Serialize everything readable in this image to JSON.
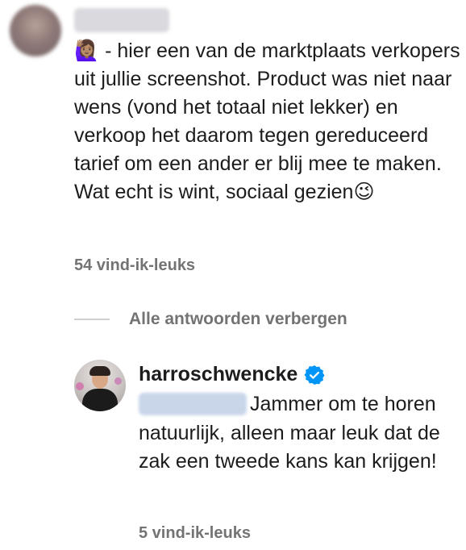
{
  "comment": {
    "text": "🙋🏽‍♀️ - hier een van de marktplaats verkopers uit jullie screenshot. Product was niet naar wens (vond het totaal niet lekker) en verkoop het daarom tegen gereduceerd tarief om een ander er blij mee te maken. Wat echt is wint, sociaal gezien😉",
    "likes": "54 vind-ik-leuks"
  },
  "replies_toggle": {
    "label": "Alle antwoorden verbergen"
  },
  "reply": {
    "username": "harroschwencke",
    "text": "Jammer om te horen natuurlijk, alleen maar leuk dat de zak een tweede kans kan krijgen!",
    "likes": "5 vind-ik-leuks"
  },
  "colors": {
    "text": "#1c1c1e",
    "muted": "#737373",
    "verified_blue": "#0095f6"
  },
  "icons": {
    "verified": "verified-badge-icon"
  }
}
